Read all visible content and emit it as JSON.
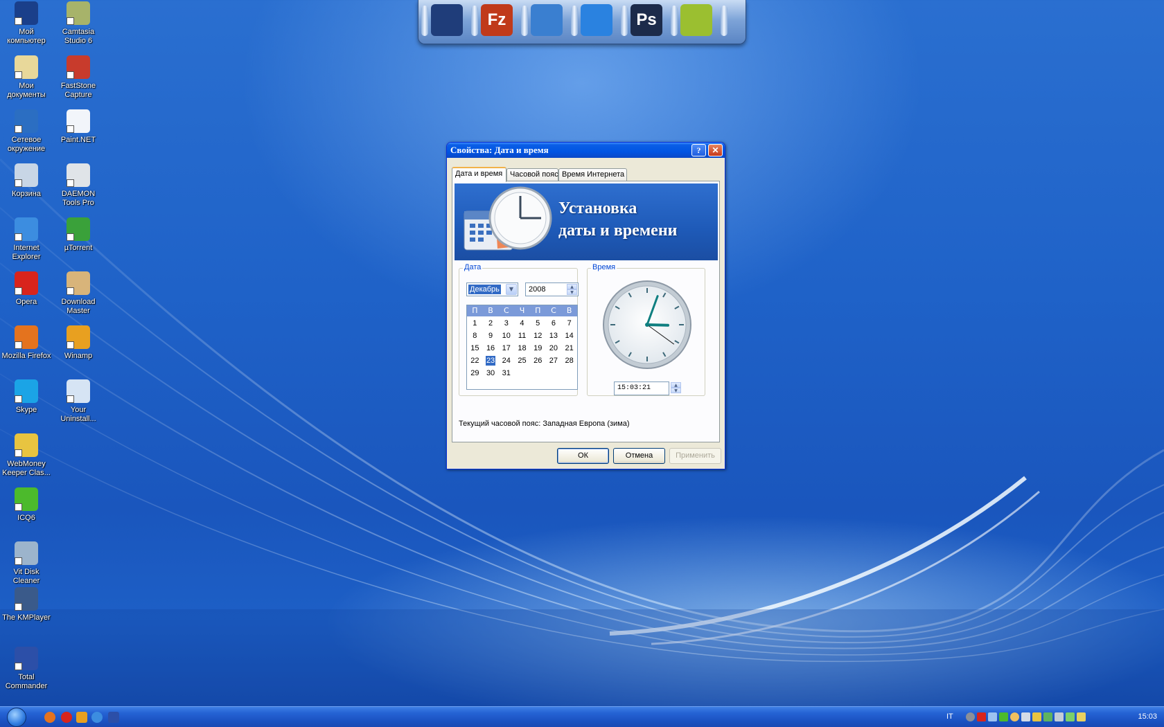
{
  "desktop": {
    "icons": [
      {
        "label": "Мой компьютер",
        "icon": "computer-icon",
        "color": "#1a3f8a"
      },
      {
        "label": "Camtasia Studio 6",
        "icon": "camtasia-icon",
        "color": "#a7b36a"
      },
      {
        "label": "Мои документы",
        "icon": "documents-icon",
        "color": "#e8d89a"
      },
      {
        "label": "FastStone Capture",
        "icon": "faststone-icon",
        "color": "#c83b2c"
      },
      {
        "label": "Сетевое окружение",
        "icon": "network-icon",
        "color": "#2b6ec2"
      },
      {
        "label": "Paint.NET",
        "icon": "paintnet-icon",
        "color": "#f2f5fa"
      },
      {
        "label": "Корзина",
        "icon": "recycle-bin-icon",
        "color": "#c8d6e6"
      },
      {
        "label": "DAEMON Tools Pro",
        "icon": "daemon-tools-icon",
        "color": "#e0e4e8"
      },
      {
        "label": "Internet Explorer",
        "icon": "internet-explorer-icon",
        "color": "#3c8de0"
      },
      {
        "label": "µTorrent",
        "icon": "utorrent-icon",
        "color": "#3aa13a"
      },
      {
        "label": "Opera",
        "icon": "opera-icon",
        "color": "#d8241c"
      },
      {
        "label": "Download Master",
        "icon": "download-master-icon",
        "color": "#d8b47a"
      },
      {
        "label": "Mozilla Firefox",
        "icon": "firefox-icon",
        "color": "#e4731e"
      },
      {
        "label": "Winamp",
        "icon": "winamp-icon",
        "color": "#e8a020"
      },
      {
        "label": "Skype",
        "icon": "skype-icon",
        "color": "#1ba4e6"
      },
      {
        "label": "Your Uninstall...",
        "icon": "uninstaller-icon",
        "color": "#d6e4f4"
      },
      {
        "label": "WebMoney Keeper Clas...",
        "icon": "webmoney-icon",
        "color": "#e8c440"
      },
      {
        "label": "ICQ6",
        "icon": "icq-icon",
        "color": "#4cba2c"
      },
      {
        "label": "Vit Disk Cleaner",
        "icon": "disk-cleaner-icon",
        "color": "#9cb4cc"
      },
      {
        "label": "The KMPlayer",
        "icon": "kmplayer-icon",
        "color": "#3a5a8a"
      },
      {
        "label": "Total Commander",
        "icon": "total-commander-icon",
        "color": "#2c4fa8"
      }
    ]
  },
  "dock": {
    "items": [
      {
        "icon": "monitor-icon",
        "text": ""
      },
      {
        "icon": "filezilla-icon",
        "text": "Fz"
      },
      {
        "icon": "globe-icon",
        "text": ""
      },
      {
        "icon": "upload-arrow-icon",
        "text": ""
      },
      {
        "icon": "photoshop-icon",
        "text": "Ps"
      },
      {
        "icon": "dreamweaver-icon",
        "text": ""
      }
    ]
  },
  "dialog": {
    "title": "Свойства: Дата и время",
    "tabs": [
      "Дата и время",
      "Часовой пояс",
      "Время Интернета"
    ],
    "banner_line1": "Установка",
    "banner_line2": "даты и времени",
    "date_group_label": "Дата",
    "time_group_label": "Время",
    "month": "Декабрь",
    "year": "2008",
    "weekdays": [
      "П",
      "В",
      "С",
      "Ч",
      "П",
      "С",
      "В"
    ],
    "days": [
      "1",
      "2",
      "3",
      "4",
      "5",
      "6",
      "7",
      "8",
      "9",
      "10",
      "11",
      "12",
      "13",
      "14",
      "15",
      "16",
      "17",
      "18",
      "19",
      "20",
      "21",
      "22",
      "23",
      "24",
      "25",
      "26",
      "27",
      "28",
      "29",
      "30",
      "31"
    ],
    "selected_day": "23",
    "time_value": "15:03:21",
    "clock": {
      "hours": 15,
      "minutes": 3,
      "seconds": 21
    },
    "timezone_text": "Текущий часовой пояс: Западная Европа (зима)",
    "ok_label": "ОК",
    "cancel_label": "Отмена",
    "apply_label": "Применить"
  },
  "taskbar": {
    "language": "IT",
    "time": "15:03"
  },
  "colors": {
    "title_bar": "#0054e3",
    "selection": "#316ac5",
    "desktop": "#1f62c8"
  }
}
